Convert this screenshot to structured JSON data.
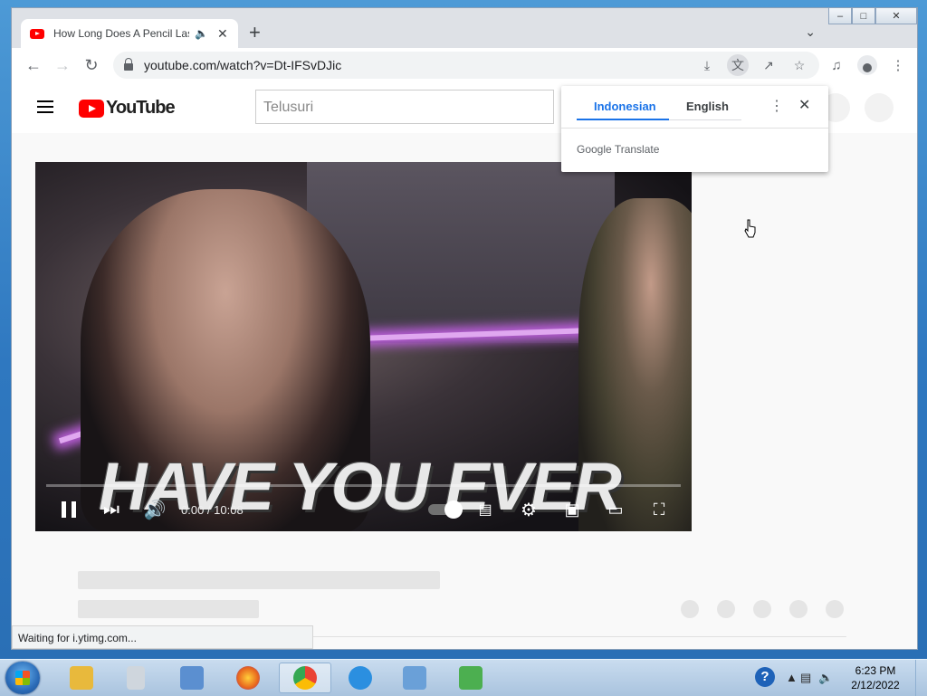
{
  "browser": {
    "tab_title": "How Long Does A Pencil Last?",
    "url": "youtube.com/watch?v=Dt-IFSvDJic",
    "status_text": "Waiting for i.ytimg.com..."
  },
  "youtube": {
    "logo_text": "YouTube",
    "search_placeholder": "Telusuri"
  },
  "video": {
    "caption": "HAVE YOU EVER",
    "time": "0:00 / 10:08",
    "progress_fraction": 0.0
  },
  "translate_popup": {
    "source_language": "Indonesian",
    "target_language": "English",
    "brand": "Google Translate"
  },
  "taskbar": {
    "time": "6:23 PM",
    "date": "2/12/2022",
    "apps": [
      {
        "name": "file-explorer",
        "color": "#e8b93c"
      },
      {
        "name": "calculator",
        "color": "#cfd6dd"
      },
      {
        "name": "remote-desktop",
        "color": "#5b8fd0"
      },
      {
        "name": "firefox",
        "color": "#e8661d"
      },
      {
        "name": "chrome",
        "color": "#34a853"
      },
      {
        "name": "internet-explorer",
        "color": "#2b8fe0"
      },
      {
        "name": "search-tool",
        "color": "#6aa0d8"
      },
      {
        "name": "chart-tool",
        "color": "#4caf50"
      }
    ]
  },
  "colors": {
    "youtube_red": "#ff0000",
    "accent_blue": "#1a73e8"
  }
}
